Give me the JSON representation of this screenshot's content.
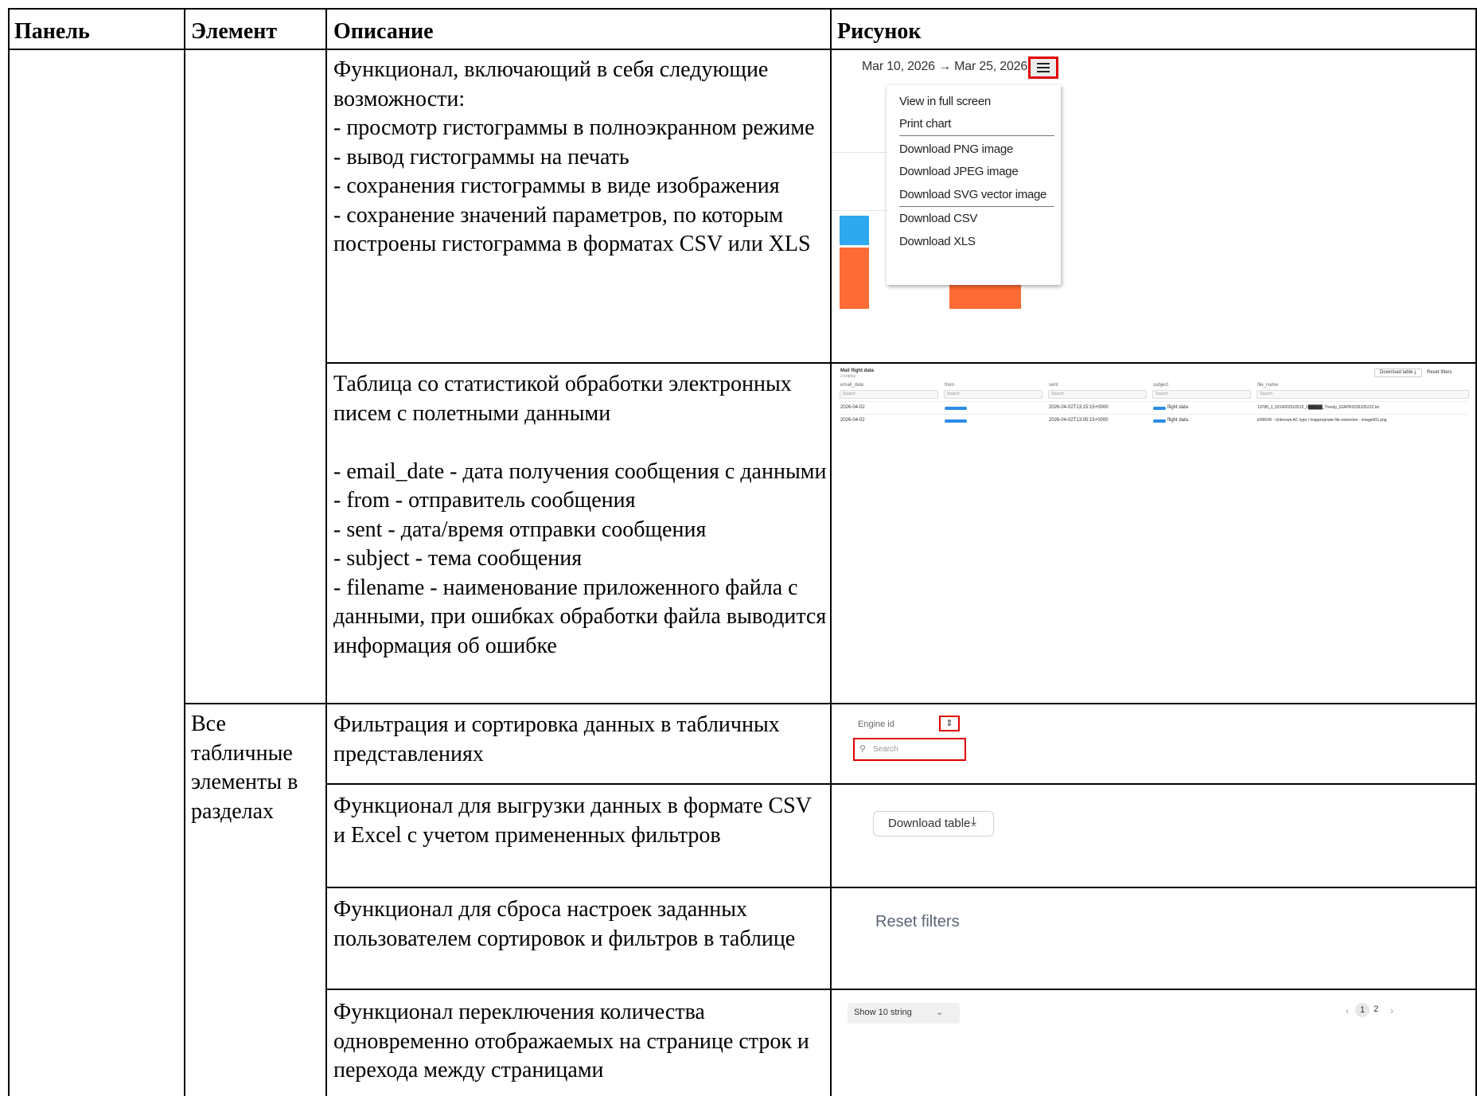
{
  "table": {
    "headers": [
      "Панель",
      "Элемент",
      "Описание",
      "Рисунок"
    ],
    "rows": [
      {
        "panel": "",
        "element": "",
        "description": "Функционал, включающий в себя следующие возможности:\n- просмотр гистограммы в полноэкранном режиме\n- вывод гистограммы на печать\n- сохранения гистограммы в виде изображения\n- сохранение значений параметров, по которым построены гистограмма в форматах CSV или XLS"
      },
      {
        "panel": "",
        "element": "",
        "description": "Таблица со статистикой обработки электронных писем с полетными данными\n\n- email_date - дата получения сообщения с данными\n- from - отправитель сообщения\n- sent - дата/время отправки сообщения\n- subject - тема сообщения\n- filename - наименование приложенного файла с данными, при ошибках обработки файла выводится информация об ошибке"
      },
      {
        "panel": "",
        "element": "Все табличные элементы в разделах",
        "description": "Фильтрация и сортировка данных в табличных представлениях"
      },
      {
        "panel": "",
        "element": "",
        "description": "Функционал для выгрузки данных в формате CSV и Excel с учетом примененных фильтров"
      },
      {
        "panel": "",
        "element": "",
        "description": "Функционал для сброса настроек заданных пользователем сортировок и фильтров в таблице"
      },
      {
        "panel": "",
        "element": "",
        "description": "Функционал переключения количества одновременно отображаемых на странице строк и перехода между страницами"
      }
    ]
  },
  "pictures": {
    "chart_menu": {
      "date_range": "Mar 10, 2026  →  Mar 25, 2026",
      "menu_items": [
        "View in full screen",
        "Print chart",
        "Download PNG image",
        "Download JPEG image",
        "Download SVG vector image",
        "Download CSV",
        "Download XLS"
      ],
      "bar_colors": [
        "#2ea8ee",
        "#ff6b35"
      ]
    },
    "mail_table": {
      "title": "Mail flight data",
      "subtitle": "2 entries",
      "download_button": "Download table",
      "reset_button": "Reset filters",
      "columns": [
        "email_date",
        "from",
        "sent",
        "subject",
        "file_name"
      ],
      "search_placeholder": "Search",
      "rows": [
        {
          "email_date": "2026-04-02",
          "sent": "2026-04-02T13:15:15+0000",
          "subject": "flight data",
          "file_name": "13785_1_0224202510515_0█████_Trendy_02APR2026105222.txt"
        },
        {
          "email_date": "2026-04-02",
          "sent": "2026-04-02T13:05:15+0000",
          "subject": "flight data",
          "file_name": "ERROR - Unknown AC type / Inappropriate file extension - image001.png"
        }
      ]
    },
    "filter": {
      "column_label": "Engine id",
      "search_placeholder": "Search"
    },
    "download": {
      "label": "Download table"
    },
    "reset": {
      "label": "Reset filters"
    },
    "pagination": {
      "show_select": "Show 10 string",
      "pages": [
        "1",
        "2"
      ],
      "current_page": "1"
    }
  }
}
